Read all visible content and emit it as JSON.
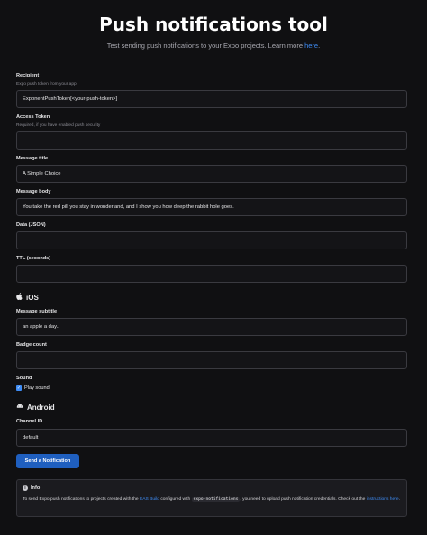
{
  "header": {
    "title": "Push notifications tool",
    "subtitle_prefix": "Test sending push notifications to your Expo projects. Learn more ",
    "subtitle_link": "here",
    "subtitle_suffix": "."
  },
  "fields": {
    "recipient": {
      "label": "Recipient",
      "hint": "Expo push token from your app",
      "value": "ExponentPushToken[<your-push-token>]"
    },
    "access_token": {
      "label": "Access Token",
      "hint": "Required, if you have enabled push security",
      "value": ""
    },
    "message_title": {
      "label": "Message title",
      "value": "A Simple Choice"
    },
    "message_body": {
      "label": "Message body",
      "value": "You take the red pill you stay in wonderland, and I show you how deep the rabbit hole goes."
    },
    "data_json": {
      "label": "Data (JSON)",
      "value": ""
    },
    "ttl": {
      "label": "TTL (seconds)",
      "value": ""
    }
  },
  "ios": {
    "section_label": "iOS",
    "icon": "apple-icon",
    "message_subtitle": {
      "label": "Message subtitle",
      "value": "an apple a day.."
    },
    "badge_count": {
      "label": "Badge count",
      "value": ""
    },
    "sound": {
      "label": "Sound",
      "checkbox_label": "Play sound",
      "checked": true
    }
  },
  "android": {
    "section_label": "Android",
    "icon": "android-icon",
    "channel_id": {
      "label": "Channel ID",
      "value": "default"
    }
  },
  "send_button": {
    "label": "Send a Notification"
  },
  "info": {
    "title": "Info",
    "text_1": "To send Expo push notifications to projects created with the ",
    "link_1": "EAS Build",
    "text_2": " configured with ",
    "code": "expo-notifications",
    "text_3": ", you need to upload push notification credentials. Check out the ",
    "link_2": "instructions here",
    "text_4": "."
  },
  "colors": {
    "background": "#101012",
    "accent": "#3e8cf5",
    "button": "#1f5fbf",
    "field_border": "#3a3a40"
  }
}
